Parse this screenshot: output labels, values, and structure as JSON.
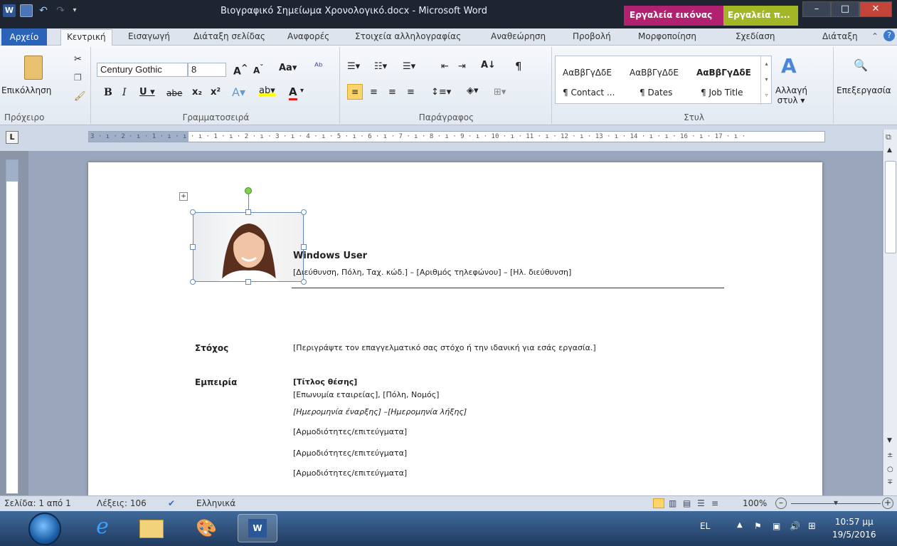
{
  "window": {
    "title": "Βιογραφικό Σημείωμα Χρονολογικό.docx - Microsoft Word",
    "context_tab_1": "Εργαλεία εικόνας",
    "context_tab_2": "Εργαλεία π..."
  },
  "tabs": {
    "file": "Αρχείο",
    "home": "Κεντρική",
    "insert": "Εισαγωγή",
    "layout": "Διάταξη σελίδας",
    "references": "Αναφορές",
    "mailings": "Στοιχεία αλληλογραφίας",
    "review": "Αναθεώρηση",
    "view": "Προβολή",
    "format": "Μορφοποίηση",
    "design": "Σχεδίαση",
    "arrange": "Διάταξη"
  },
  "ribbon": {
    "clipboard": {
      "paste": "Επικόλληση",
      "label": "Πρόχειρο"
    },
    "font": {
      "name": "Century Gothic",
      "size": "8",
      "label": "Γραμματοσειρά"
    },
    "paragraph": {
      "label": "Παράγραφος"
    },
    "styles": {
      "label": "Στυλ",
      "preview_1": "AαBβΓγΔδE",
      "preview_2": "AαBβΓγΔδE",
      "preview_3": "AαBβΓγΔδE",
      "name_1": "¶ Contact ...",
      "name_2": "¶ Dates",
      "name_3": "¶ Job Title",
      "change_styles_1": "Αλλαγή",
      "change_styles_2": "στυλ ▾"
    },
    "editing": {
      "label": "Επεξεργασία"
    }
  },
  "ruler_text": "3 · ı · 2 · ı · 1 · ı · ı · ı · 1 · ı · 2 · ı · 3 · ı · 4 · ı · 5 · ı · 6 · ı · 7 · ı · 8 · ı · 9 · ı · 10 · ı · 11 · ı · 12 · ı · 13 · ı · 14 · ı · ı · 16 · ı · 17 · ı ·",
  "document": {
    "name": "Windows User",
    "contact": "[Διεύθυνση, Πόλη, Ταχ. κώδ.] – [Αριθμός τηλεφώνου] – [Ηλ. διεύθυνση]",
    "objective_label": "Στόχος",
    "objective_text": "[Περιγράψτε τον επαγγελματικό σας στόχο ή την ιδανική για εσάς εργασία.]",
    "experience_label": "Εμπειρία",
    "job_title": "[Τίτλος θέσης]",
    "company": "[Επωνυμία εταιρείας], [Πόλη, Νομός]",
    "dates": "[Ημερομηνία έναρξης] –[Ημερομηνία λήξης]",
    "duties": [
      "[Αρμοδιότητες/επιτεύγματα]",
      "[Αρμοδιότητες/επιτεύγματα]",
      "[Αρμοδιότητες/επιτεύγματα]"
    ]
  },
  "status": {
    "page": "Σελίδα: 1 από 1",
    "words": "Λέξεις: 106",
    "language": "Ελληνικά",
    "zoom": "100%"
  },
  "taskbar": {
    "lang": "EL",
    "time": "10:57 μμ",
    "date": "19/5/2016"
  },
  "colors": {
    "picture_tools": "#b2216f",
    "table_tools": "#a3b626",
    "file_tab": "#2b63b8"
  }
}
